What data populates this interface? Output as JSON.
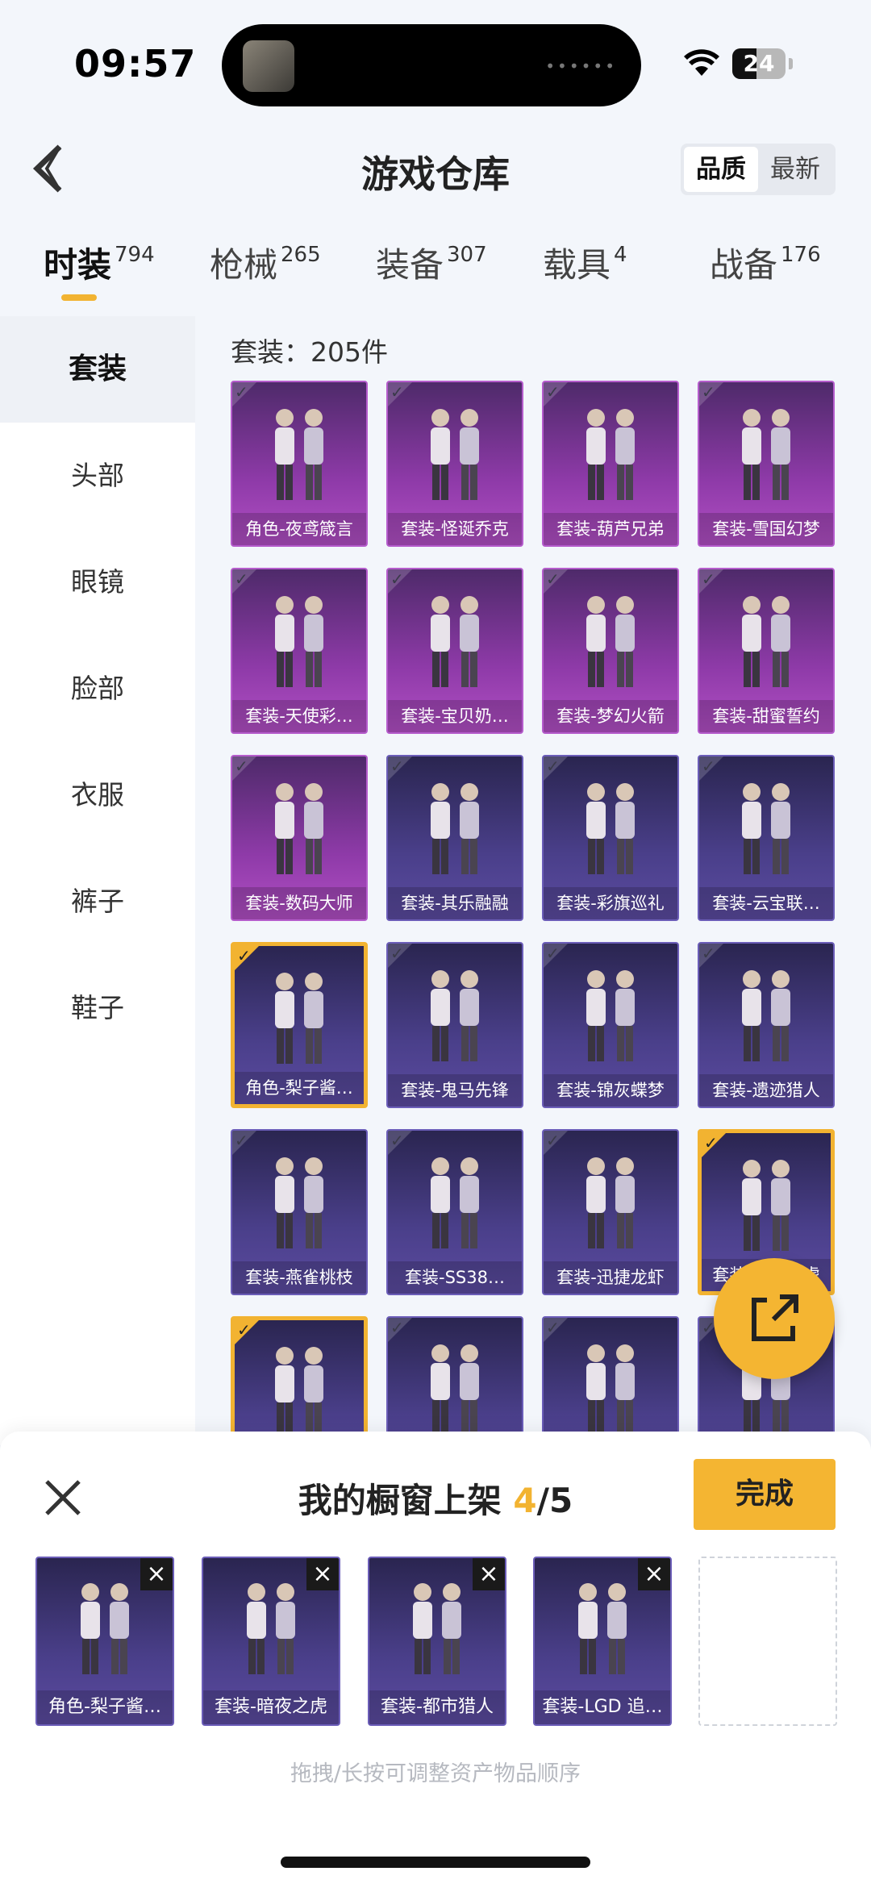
{
  "status_bar": {
    "time": "09:57",
    "battery": "24",
    "icons": [
      "wifi-icon",
      "battery-icon"
    ]
  },
  "header": {
    "title": "游戏仓库",
    "sort_options": [
      "品质",
      "最新"
    ],
    "active_sort": "品质"
  },
  "tabs": [
    {
      "label": "时装",
      "count": "794",
      "active": true
    },
    {
      "label": "枪械",
      "count": "265"
    },
    {
      "label": "装备",
      "count": "307"
    },
    {
      "label": "载具",
      "count": "4"
    },
    {
      "label": "战备",
      "count": "176"
    }
  ],
  "sidebar": {
    "items": [
      "套装",
      "头部",
      "眼镜",
      "脸部",
      "衣服",
      "裤子",
      "鞋子"
    ],
    "active": "套装"
  },
  "grid": {
    "count_label": "套装：205件",
    "items": [
      {
        "label": "角色-夜鸢箴言",
        "rarity": "purple",
        "selected": false
      },
      {
        "label": "套装-怪诞乔克",
        "rarity": "purple",
        "selected": false
      },
      {
        "label": "套装-葫芦兄弟",
        "rarity": "purple",
        "selected": false
      },
      {
        "label": "套装-雪国幻梦",
        "rarity": "purple",
        "selected": false
      },
      {
        "label": "套装-天使彩…",
        "rarity": "purple",
        "selected": false
      },
      {
        "label": "套装-宝贝奶…",
        "rarity": "purple",
        "selected": false
      },
      {
        "label": "套装-梦幻火箭",
        "rarity": "purple",
        "selected": false
      },
      {
        "label": "套装-甜蜜誓约",
        "rarity": "purple",
        "selected": false
      },
      {
        "label": "套装-数码大师",
        "rarity": "purple",
        "selected": false
      },
      {
        "label": "套装-其乐融融",
        "rarity": "blue",
        "selected": false
      },
      {
        "label": "套装-彩旗巡礼",
        "rarity": "blue",
        "selected": false
      },
      {
        "label": "套装-云宝联…",
        "rarity": "blue",
        "selected": false
      },
      {
        "label": "角色-梨子酱…",
        "rarity": "blue",
        "selected": true
      },
      {
        "label": "套装-鬼马先锋",
        "rarity": "blue",
        "selected": false
      },
      {
        "label": "套装-锦灰蝶梦",
        "rarity": "blue",
        "selected": false
      },
      {
        "label": "套装-遗迹猎人",
        "rarity": "blue",
        "selected": false
      },
      {
        "label": "套装-燕雀桃枝",
        "rarity": "blue",
        "selected": false
      },
      {
        "label": "套装-SS38…",
        "rarity": "blue",
        "selected": false
      },
      {
        "label": "套装-迅捷龙虾",
        "rarity": "blue",
        "selected": false
      },
      {
        "label": "套装-暗夜之虎",
        "rarity": "blue",
        "selected": true
      },
      {
        "label": "",
        "rarity": "blue",
        "selected": true
      },
      {
        "label": "",
        "rarity": "blue",
        "selected": false
      },
      {
        "label": "",
        "rarity": "blue",
        "selected": false
      },
      {
        "label": "",
        "rarity": "blue",
        "selected": false
      }
    ]
  },
  "showcase": {
    "title": "我的橱窗上架",
    "current": "4",
    "max": "/5",
    "done_label": "完成",
    "slots": [
      "角色-梨子酱…",
      "套装-暗夜之虎",
      "套装-都市猎人",
      "套装-LGD 追…"
    ],
    "hint": "拖拽/长按可调整资产物品顺序"
  },
  "colors": {
    "accent": "#f2b331",
    "purple_card": "#8e3aa8",
    "blue_card": "#4a3f8a"
  }
}
